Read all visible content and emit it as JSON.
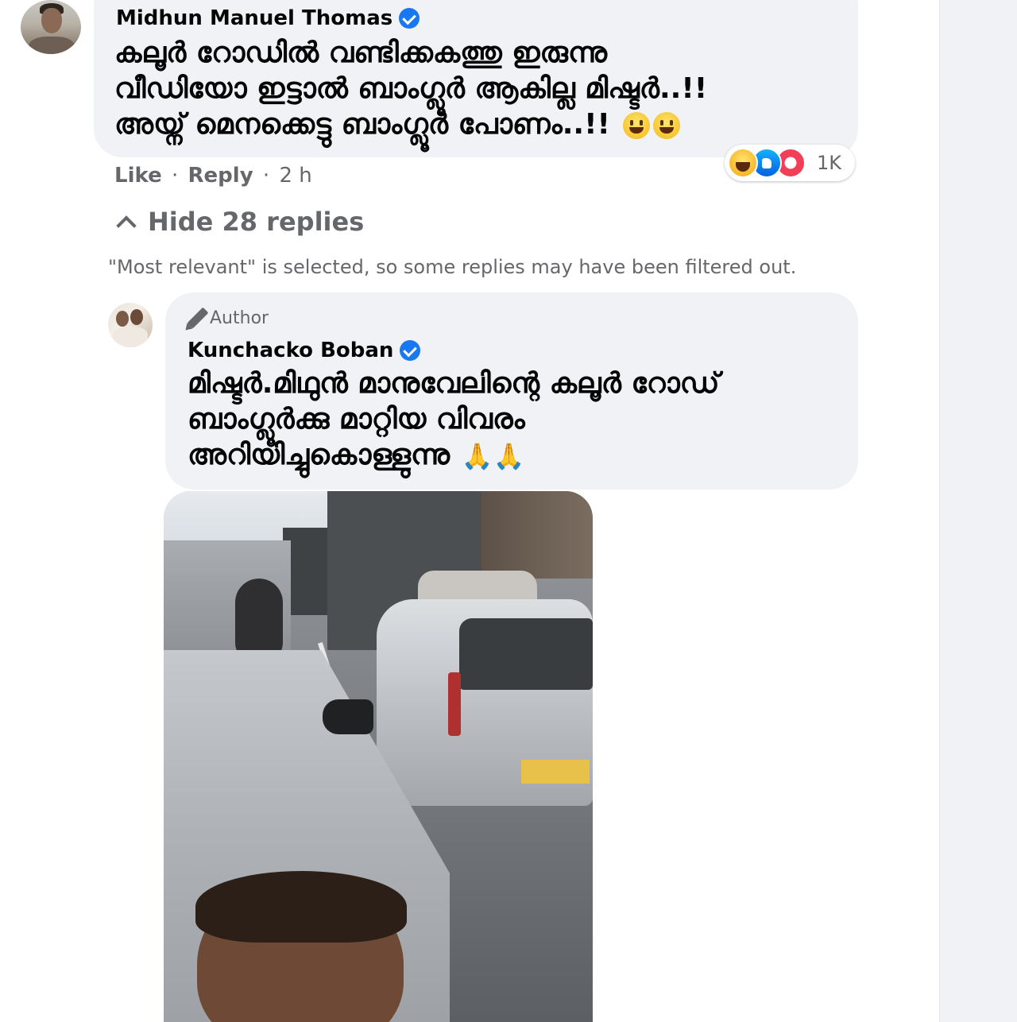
{
  "comment": {
    "author": "Midhun Manuel Thomas",
    "text_lines": [
      "കലൂർ റോഡിൽ വണ്ടിക്കകത്തു ഇരുന്നു",
      "വീഡിയോ ഇട്ടാൽ ബാംഗ്ലൂർ ആകില്ല മിഷ്ടർ..!!",
      "അയ്ന് മെനക്കെട്ടു ബാംഗ്ലൂർ പോണം..!!"
    ],
    "emoji": [
      "grinning-face",
      "grinning-face"
    ],
    "actions": {
      "like": "Like",
      "dot": "·",
      "reply": "Reply",
      "time": "2 h"
    },
    "reactions": {
      "icons": [
        "haha",
        "like",
        "care"
      ],
      "count": "1K"
    }
  },
  "replies": {
    "toggle_label": "Hide 28 replies",
    "filter_note": "\"Most relevant\" is selected, so some replies may have been filtered out."
  },
  "reply": {
    "badge": "Author",
    "author": "Kunchacko Boban",
    "text_lines": [
      "മിഷ്ടർ.മിഥുൻ മാനുവേലിന്റെ കലൂർ റോഡ്",
      "ബാംഗ്ലൂർക്കു മാറ്റിയ വിവരം",
      "അറിയിച്ചുകൊള്ളുന്നു"
    ],
    "emoji": "🙏🙏"
  },
  "colors": {
    "bubble": "#f0f2f5",
    "secondary_text": "#65676b",
    "verified": "#1877f2"
  }
}
